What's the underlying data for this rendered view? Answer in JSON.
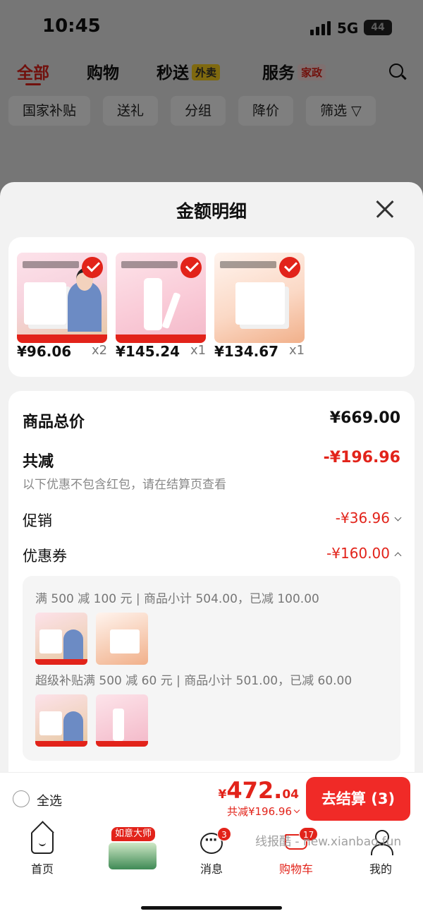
{
  "status": {
    "time": "10:45",
    "network": "5G",
    "battery": "44"
  },
  "top_nav": {
    "tabs": [
      {
        "label": "全部"
      },
      {
        "label": "购物"
      },
      {
        "label": "秒送",
        "tag": "外卖"
      },
      {
        "label": "服务",
        "tag": "家政"
      }
    ]
  },
  "filters": [
    "国家补贴",
    "送礼",
    "分组",
    "降价",
    "筛选"
  ],
  "sheet": {
    "title": "金额明细",
    "products": [
      {
        "price": "¥96.06",
        "qty": "x2"
      },
      {
        "price": "¥145.24",
        "qty": "x1"
      },
      {
        "price": "¥134.67",
        "qty": "x1"
      }
    ],
    "summary": {
      "total_label": "商品总价",
      "total_value": "¥669.00",
      "discount_label": "共减",
      "discount_value": "-¥196.96",
      "note": "以下优惠不包含红包，请在结算页查看",
      "promo_label": "促销",
      "promo_value": "-¥36.96",
      "coupon_label": "优惠券",
      "coupon_value": "-¥160.00"
    },
    "coupons": [
      {
        "text": "满 500 减 100 元 | 商品小计 504.00，已减 100.00"
      },
      {
        "text": "超级补贴满 500 减 60 元 | 商品小计 501.00，已减 60.00"
      }
    ]
  },
  "checkout": {
    "select_all": "全选",
    "currency": "¥",
    "amount_int": "472.",
    "amount_dec": "04",
    "saved": "共减¥196.96",
    "button": "去结算 (3)"
  },
  "tabbar": {
    "items": [
      {
        "label": "首页"
      },
      {
        "label": "消息",
        "badge": "3"
      },
      {
        "label": "购物车",
        "badge": "17"
      },
      {
        "label": "我的"
      }
    ],
    "promo_tag": "如意大师"
  },
  "watermark": "线报酷 - new.xianbao.fun",
  "colors": {
    "accent": "#e2231a",
    "button": "#f02a27"
  }
}
